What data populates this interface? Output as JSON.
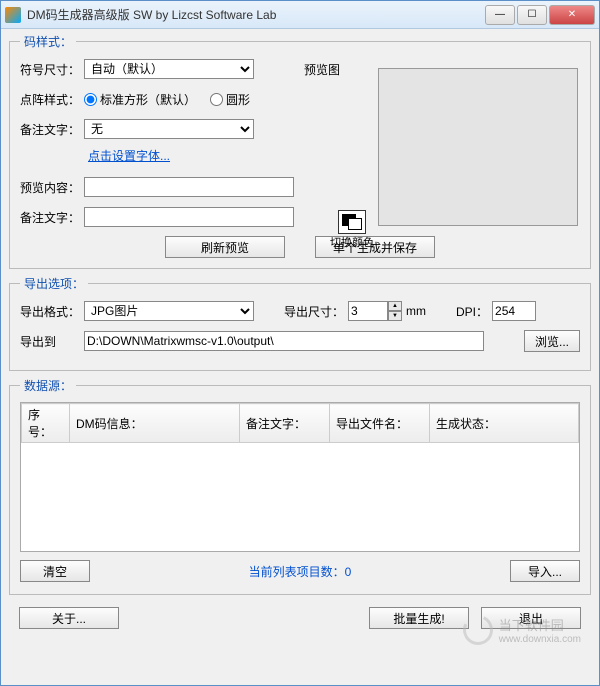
{
  "titlebar": {
    "title": "DM码生成器高级版 SW  by Lizcst Software Lab"
  },
  "style_group": {
    "legend": "码样式：",
    "symbol_size_label": "符号尺寸：",
    "symbol_size_value": "自动（默认）",
    "preview_label": "预览图",
    "dot_style_label": "点阵样式：",
    "dot_style_square": "标准方形（默认）",
    "dot_style_circle": "圆形",
    "note_label": "备注文字：",
    "note_value": "无",
    "font_link": "点击设置字体...",
    "preview_content_label": "预览内容：",
    "preview_content_value": "",
    "note2_label": "备注文字：",
    "note2_value": "",
    "swap_color_label": "切换颜色",
    "btn_refresh": "刷新预览",
    "btn_generate_single": "单个生成并保存"
  },
  "export_group": {
    "legend": "导出选项：",
    "format_label": "导出格式：",
    "format_value": "JPG图片",
    "size_label": "导出尺寸：",
    "size_value": "3",
    "size_unit": "mm",
    "dpi_label": "DPI：",
    "dpi_value": "254",
    "path_label": "导出到",
    "path_value": "D:\\DOWN\\Matrixwmsc-v1.0\\output\\",
    "browse_btn": "浏览..."
  },
  "data_group": {
    "legend": "数据源：",
    "columns": [
      "序号：",
      "DM码信息：",
      "备注文字：",
      "导出文件名：",
      "生成状态："
    ],
    "clear_btn": "清空",
    "status_text": "当前列表项目数：0",
    "import_btn": "导入..."
  },
  "bottom": {
    "about_btn": "关于...",
    "batch_btn": "批量生成!",
    "exit_btn": "退出"
  },
  "watermark": {
    "text1": "当下软件园",
    "text2": "www.downxia.com"
  }
}
